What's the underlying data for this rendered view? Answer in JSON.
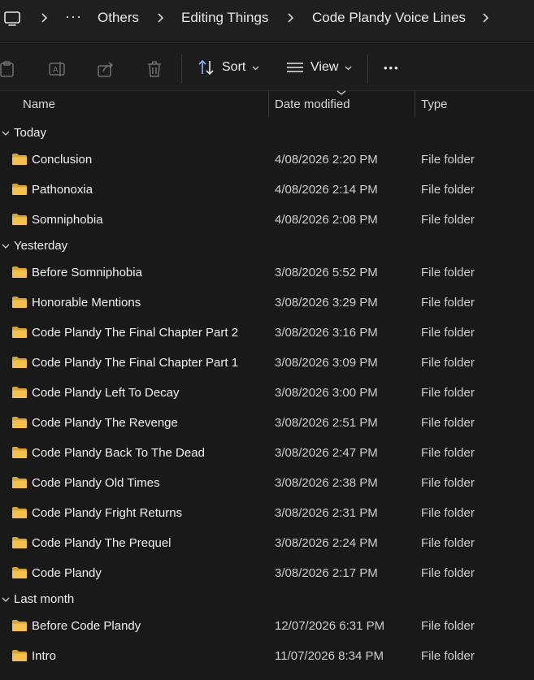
{
  "breadcrumb": {
    "pc_icon": "this-pc-icon",
    "overflow": "···",
    "items": [
      "Others",
      "Editing Things",
      "Code Plandy Voice Lines"
    ]
  },
  "toolbar": {
    "sort_label": "Sort",
    "view_label": "View",
    "more_label": "•••",
    "icons": [
      "paste-icon",
      "rename-icon",
      "share-icon",
      "delete-icon",
      "sort-icon",
      "view-icon"
    ]
  },
  "columns": {
    "name": "Name",
    "date": "Date modified",
    "type": "Type"
  },
  "groups": [
    {
      "label": "Today",
      "items": [
        {
          "name": "Conclusion",
          "date": "4/08/2026 2:20 PM",
          "type": "File folder"
        },
        {
          "name": "Pathonoxia",
          "date": "4/08/2026 2:14 PM",
          "type": "File folder"
        },
        {
          "name": "Somniphobia",
          "date": "4/08/2026 2:08 PM",
          "type": "File folder"
        }
      ]
    },
    {
      "label": "Yesterday",
      "items": [
        {
          "name": "Before Somniphobia",
          "date": "3/08/2026 5:52 PM",
          "type": "File folder"
        },
        {
          "name": "Honorable Mentions",
          "date": "3/08/2026 3:29 PM",
          "type": "File folder"
        },
        {
          "name": "Code Plandy The Final Chapter Part 2",
          "date": "3/08/2026 3:16 PM",
          "type": "File folder"
        },
        {
          "name": "Code Plandy The Final Chapter Part 1",
          "date": "3/08/2026 3:09 PM",
          "type": "File folder"
        },
        {
          "name": "Code Plandy Left To Decay",
          "date": "3/08/2026 3:00 PM",
          "type": "File folder"
        },
        {
          "name": "Code Plandy The Revenge",
          "date": "3/08/2026 2:51 PM",
          "type": "File folder"
        },
        {
          "name": "Code Plandy Back To The Dead",
          "date": "3/08/2026 2:47 PM",
          "type": "File folder"
        },
        {
          "name": "Code Plandy Old Times",
          "date": "3/08/2026 2:38 PM",
          "type": "File folder"
        },
        {
          "name": "Code Plandy Fright Returns",
          "date": "3/08/2026 2:31 PM",
          "type": "File folder"
        },
        {
          "name": "Code Plandy The Prequel",
          "date": "3/08/2026 2:24 PM",
          "type": "File folder"
        },
        {
          "name": "Code Plandy",
          "date": "3/08/2026 2:17 PM",
          "type": "File folder"
        }
      ]
    },
    {
      "label": "Last month",
      "items": [
        {
          "name": "Before Code Plandy",
          "date": "12/07/2026 6:31 PM",
          "type": "File folder"
        },
        {
          "name": "Intro",
          "date": "11/07/2026 8:34 PM",
          "type": "File folder"
        }
      ]
    }
  ],
  "colors": {
    "background": "#191919",
    "folder": "#f2c14e",
    "folder_dark": "#d9a532",
    "text": "#f0f0f0"
  }
}
